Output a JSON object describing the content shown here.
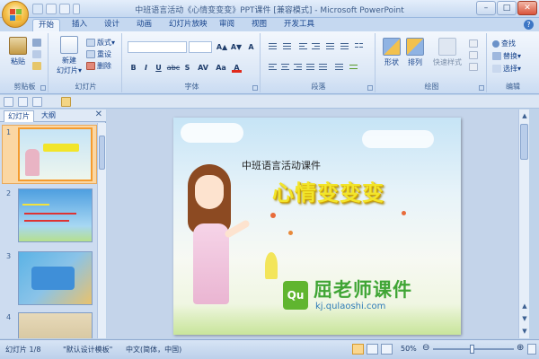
{
  "window": {
    "title": "中班语言活动《心情变变变》PPT课件 [兼容模式] - Microsoft PowerPoint",
    "minimize": "–",
    "maximize": "□",
    "close": "✕"
  },
  "tabs": [
    "开始",
    "插入",
    "设计",
    "动画",
    "幻灯片放映",
    "审阅",
    "视图",
    "开发工具"
  ],
  "ribbon": {
    "clipboard": {
      "label": "剪贴板",
      "paste": "粘贴"
    },
    "slides": {
      "label": "幻灯片",
      "new_slide": "新建",
      "new_slide2": "幻灯片▾",
      "layout": "版式▾",
      "reset": "重设",
      "delete": "删除"
    },
    "font": {
      "label": "字体",
      "font_name": "",
      "font_size": "",
      "grow": "A▲",
      "shrink": "A▼",
      "clear": "A",
      "bold": "B",
      "italic": "I",
      "underline": "U",
      "strike": "abc",
      "shadow": "S",
      "spacing": "AV",
      "case": "Aa",
      "color": "A"
    },
    "paragraph": {
      "label": "段落"
    },
    "drawing": {
      "label": "绘图",
      "shapes": "形状",
      "arrange": "排列",
      "quick_styles": "快速样式"
    },
    "editing": {
      "label": "编辑",
      "find": "查找",
      "replace": "替换▾",
      "select": "选择▾"
    }
  },
  "panel": {
    "tab_slides": "幻灯片",
    "tab_outline": "大纲",
    "close": "✕",
    "thumbnails": [
      {
        "num": "1"
      },
      {
        "num": "2"
      },
      {
        "num": "3"
      },
      {
        "num": "4"
      }
    ]
  },
  "slide": {
    "subtitle": "中班语言活动课件",
    "title": "心情变变变",
    "watermark_logo": "Qu",
    "watermark_name": "屈老师课件",
    "watermark_url": "kj.qulaoshi.com"
  },
  "status": {
    "slide_pos": "幻灯片 1/8",
    "theme": "\"默认设计模板\"",
    "language": "中文(简体，中国)",
    "zoom": "50%",
    "zoom_out": "⊖",
    "zoom_in": "⊕"
  }
}
